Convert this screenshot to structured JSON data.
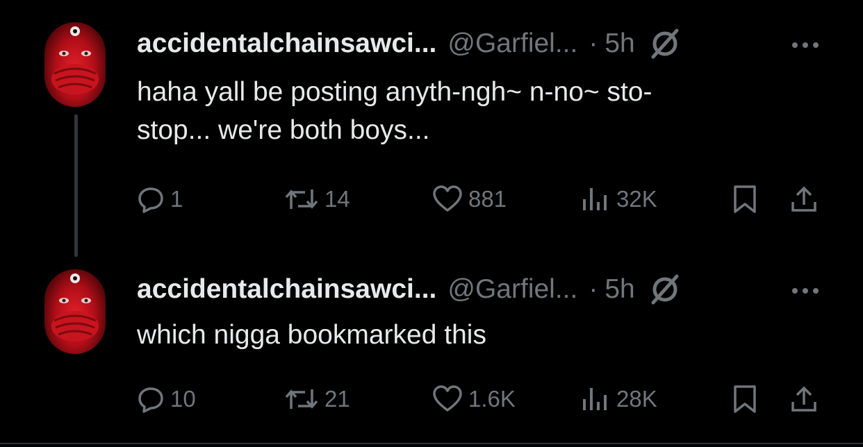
{
  "colors": {
    "background": "#000000",
    "text": "#e7e9ea",
    "muted": "#71767b",
    "thread_line": "#333639"
  },
  "tweets": [
    {
      "name": "accidentalchainsawci...",
      "handle": "@Garfiel...",
      "separator": "·",
      "time": "5h",
      "text_line1": "haha yall be posting anyth-ngh~ n-no~ sto-",
      "text_line2": "stop... we're both boys...",
      "replies": "1",
      "retweets": "14",
      "likes": "881",
      "views": "32K",
      "icons": [
        "grok-icon",
        "more-icon",
        "reply-icon",
        "retweet-icon",
        "like-icon",
        "views-icon",
        "bookmark-icon",
        "share-icon"
      ]
    },
    {
      "name": "accidentalchainsawci...",
      "handle": "@Garfiel...",
      "separator": "·",
      "time": "5h",
      "text_line1": "which nigga bookmarked this",
      "replies": "10",
      "retweets": "21",
      "likes": "1.6K",
      "views": "28K",
      "icons": [
        "grok-icon",
        "more-icon",
        "reply-icon",
        "retweet-icon",
        "like-icon",
        "views-icon",
        "bookmark-icon",
        "share-icon"
      ]
    }
  ]
}
